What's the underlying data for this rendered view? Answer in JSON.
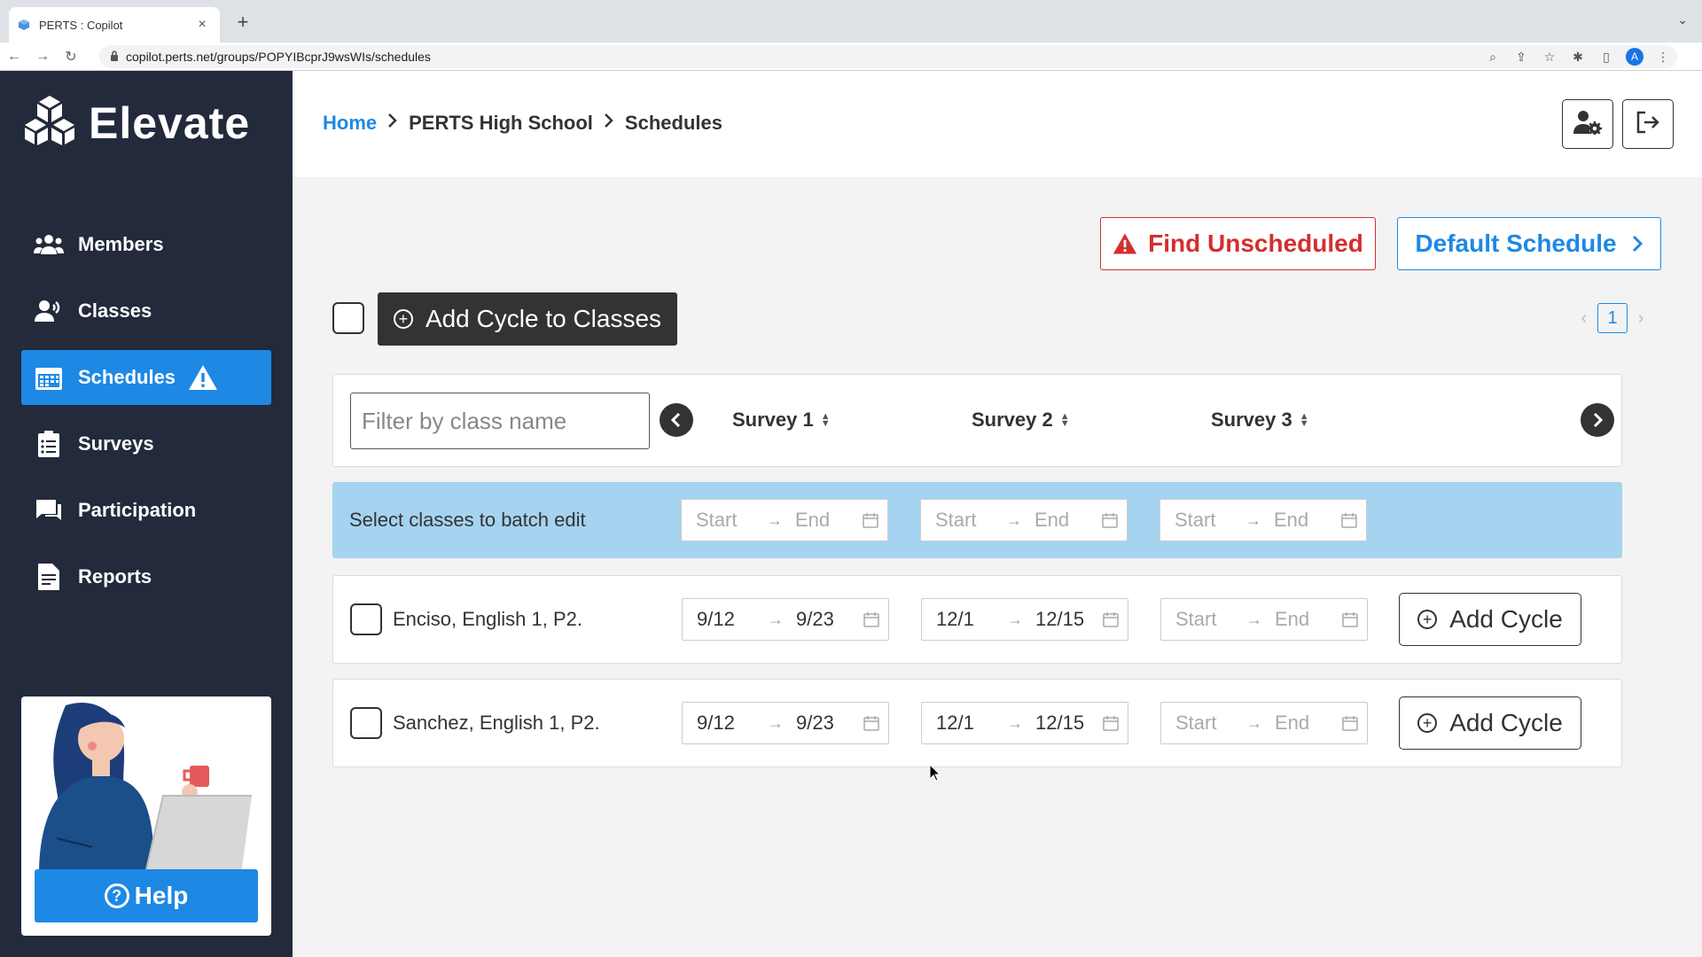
{
  "browser": {
    "tab_title": "PERTS : Copilot",
    "url": "copilot.perts.net/groups/POPYIBcprJ9wsWIs/schedules",
    "profile_initial": "A"
  },
  "sidebar": {
    "logo_text": "Elevate",
    "items": [
      {
        "label": "Members",
        "icon": "members-icon",
        "active": false
      },
      {
        "label": "Classes",
        "icon": "classes-icon",
        "active": false
      },
      {
        "label": "Schedules",
        "icon": "calendar-icon",
        "active": true,
        "warning": true
      },
      {
        "label": "Surveys",
        "icon": "clipboard-icon",
        "active": false
      },
      {
        "label": "Participation",
        "icon": "chat-icon",
        "active": false
      },
      {
        "label": "Reports",
        "icon": "report-icon",
        "active": false
      }
    ],
    "help_label": "Help"
  },
  "header": {
    "breadcrumb": [
      "Home",
      "PERTS High School",
      "Schedules"
    ]
  },
  "actions": {
    "find_unscheduled": "Find Unscheduled",
    "default_schedule": "Default Schedule",
    "add_cycle_to_classes": "Add Cycle to Classes"
  },
  "pagination": {
    "current_page": "1"
  },
  "filter": {
    "placeholder": "Filter by class name",
    "surveys": [
      "Survey 1",
      "Survey 2",
      "Survey 3"
    ]
  },
  "batch": {
    "label": "Select classes to batch edit",
    "ranges": [
      {
        "start": "Start",
        "end": "End"
      },
      {
        "start": "Start",
        "end": "End"
      },
      {
        "start": "Start",
        "end": "End"
      }
    ]
  },
  "classes": [
    {
      "name": "Enciso, English 1, P2.",
      "ranges": [
        {
          "start": "9/12",
          "end": "9/23"
        },
        {
          "start": "12/1",
          "end": "12/15"
        },
        {
          "start": "Start",
          "end": "End"
        }
      ],
      "add_cycle": "Add Cycle"
    },
    {
      "name": "Sanchez, English 1, P2.",
      "ranges": [
        {
          "start": "9/12",
          "end": "9/23"
        },
        {
          "start": "12/1",
          "end": "12/15"
        },
        {
          "start": "Start",
          "end": "End"
        }
      ],
      "add_cycle": "Add Cycle"
    }
  ],
  "colors": {
    "sidebar_bg": "#222a3b",
    "accent_blue": "#1e88e5",
    "danger_red": "#d32f2f",
    "batch_bg": "#a5d3f0"
  }
}
